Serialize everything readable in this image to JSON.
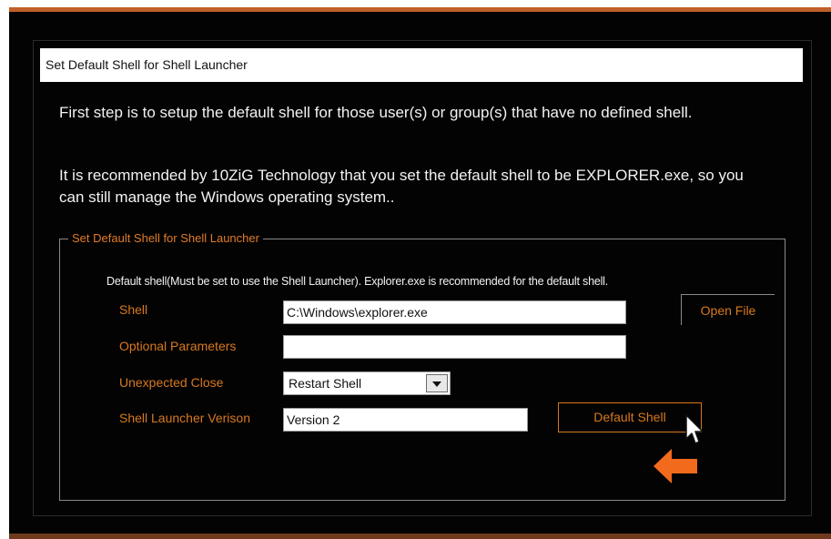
{
  "window": {
    "title": "Set Default Shell for Shell Launcher"
  },
  "intro": {
    "paragraph1": "First step is to setup the default shell for those user(s) or group(s) that have no defined shell.",
    "paragraph2": "It is recommended by 10ZiG Technology that you set the default shell to be EXPLORER.exe, so you can still manage the Windows operating system.."
  },
  "group": {
    "title": "Set Default Shell for Shell Launcher",
    "description": "Default shell(Must be set to use the Shell Launcher). Explorer.exe is recommended for the default shell.",
    "shell_label": "Shell",
    "shell_value": "C:\\Windows\\explorer.exe",
    "params_label": "Optional Parameters",
    "params_value": "",
    "close_label": "Unexpected Close",
    "close_selected": "Restart Shell",
    "version_label": "Shell Launcher Verison",
    "version_value": "Version 2",
    "open_file_label": "Open File",
    "default_shell_label": "Default Shell"
  },
  "colors": {
    "accent": "#d8781f",
    "arrow": "#f26a1b",
    "background": "#030303"
  },
  "icons": {
    "cursor": "mouse-pointer-icon",
    "pointer": "left-arrow-icon"
  }
}
